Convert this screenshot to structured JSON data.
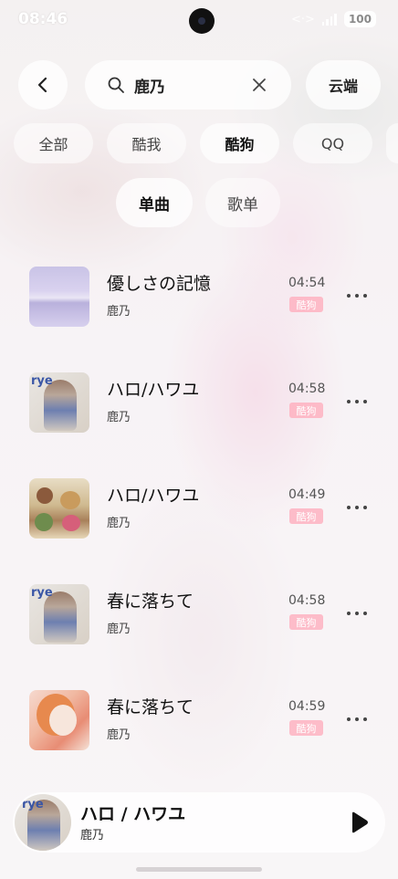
{
  "status": {
    "time": "08:46",
    "battery": "100"
  },
  "search": {
    "query": "鹿乃",
    "cloud_label": "云端"
  },
  "sources": [
    {
      "label": "全部",
      "active": false
    },
    {
      "label": "酷我",
      "active": false
    },
    {
      "label": "酷狗",
      "active": true
    },
    {
      "label": "QQ",
      "active": false
    }
  ],
  "types": [
    {
      "label": "单曲",
      "active": true
    },
    {
      "label": "歌单",
      "active": false
    }
  ],
  "songs": [
    {
      "title": "優しさの記憶",
      "artist": "鹿乃",
      "duration": "04:54",
      "source": "酷狗",
      "cover": "sea-icon"
    },
    {
      "title": "ハロ/ハワユ",
      "artist": "鹿乃",
      "duration": "04:58",
      "source": "酷狗",
      "cover": "anime-girl-icon"
    },
    {
      "title": "ハロ/ハワユ",
      "artist": "鹿乃",
      "duration": "04:49",
      "source": "酷狗",
      "cover": "food-icon"
    },
    {
      "title": "春に落ちて",
      "artist": "鹿乃",
      "duration": "04:58",
      "source": "酷狗",
      "cover": "anime-girl-icon"
    },
    {
      "title": "春に落ちて",
      "artist": "鹿乃",
      "duration": "04:59",
      "source": "酷狗",
      "cover": "autumn-girl-icon"
    }
  ],
  "cover_art_text": "rye",
  "player": {
    "title": "ハロ / ハワユ",
    "artist": "鹿乃",
    "cover": "anime-girl-icon"
  },
  "colors": {
    "source_badge": "#ffaab9",
    "accent_text": "#111111"
  }
}
